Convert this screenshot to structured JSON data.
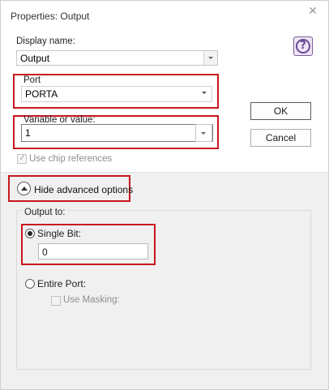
{
  "window": {
    "title": "Properties: Output",
    "close_icon": "✕"
  },
  "display_name": {
    "label": "Display name:",
    "value": "Output"
  },
  "port": {
    "label": "Port",
    "value": "PORTA"
  },
  "variable": {
    "label": "Variable or value:",
    "value": "1"
  },
  "use_chip_refs": {
    "label": "Use chip references",
    "checked": true
  },
  "buttons": {
    "ok": "OK",
    "cancel": "Cancel"
  },
  "advanced": {
    "toggle_label": "Hide advanced options"
  },
  "output_to": {
    "label": "Output to:",
    "single_bit": {
      "label": "Single Bit:",
      "value": "0",
      "selected": true
    },
    "entire_port": {
      "label": "Entire Port:",
      "selected": false
    },
    "use_masking": {
      "label": "Use Masking:",
      "checked": false
    }
  },
  "colors": {
    "highlight": "#c8171e",
    "help_accent": "#6b4a94"
  },
  "icons": {
    "help": "help-question-icon"
  }
}
